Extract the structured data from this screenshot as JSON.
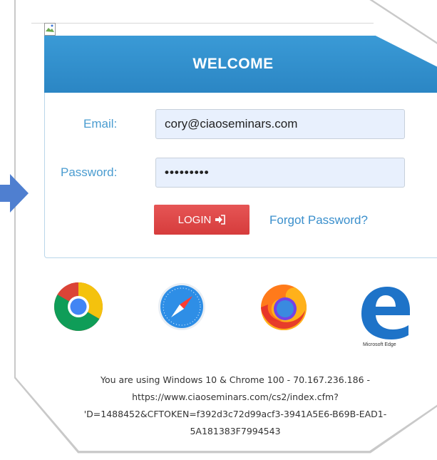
{
  "form": {
    "title": "WELCOME",
    "email_label": "Email:",
    "email_value": "cory@ciaoseminars.com",
    "password_label": "Password:",
    "password_value": "•••••••••",
    "login_label": "LOGIN",
    "forgot_label": "Forgot Password?"
  },
  "browsers": [
    {
      "icon": "chrome-icon"
    },
    {
      "icon": "safari-icon"
    },
    {
      "icon": "firefox-icon"
    },
    {
      "icon": "edge-icon",
      "caption": "Microsoft Edge"
    }
  ],
  "footer": {
    "line1": "You are using Windows 10 & Chrome 100 - 70.167.236.186 -",
    "line2": "https://www.ciaoseminars.com/cs2/index.cfm?",
    "line3": "'D=1488452&CFTOKEN=f392d3c72d99acf3-3941A5E6-B69B-EAD1-",
    "line4": "5A181383F7994543"
  },
  "colors": {
    "header_blue": "#2f8fce",
    "label_blue": "#4a9cd0",
    "login_red": "#e04848",
    "input_fill": "#e8f0fd"
  }
}
